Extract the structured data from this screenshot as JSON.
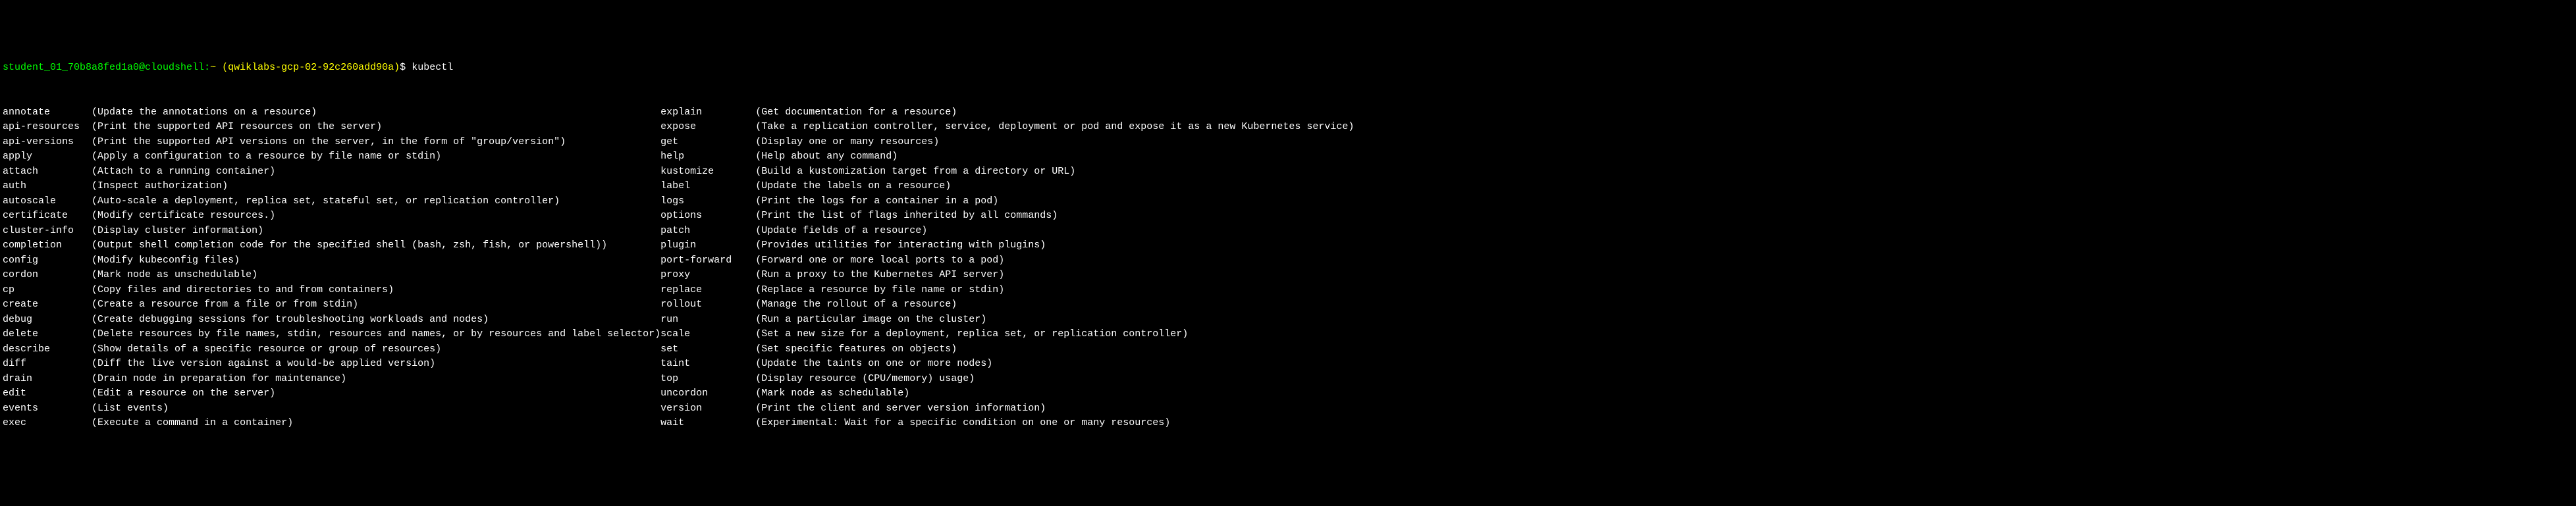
{
  "prompt": {
    "user": "student_01_70b8a8fed1a0@cloudshell",
    "separator": ":",
    "tilde": "~",
    "path_open": " (",
    "path": "qwiklabs-gcp-02-92c260add90a",
    "path_close": ")",
    "dollar": "$ ",
    "command": "kubectl"
  },
  "left_commands": [
    {
      "name": "annotate",
      "desc": "(Update the annotations on a resource)"
    },
    {
      "name": "api-resources",
      "desc": "(Print the supported API resources on the server)"
    },
    {
      "name": "api-versions",
      "desc": "(Print the supported API versions on the server, in the form of \"group/version\")"
    },
    {
      "name": "apply",
      "desc": "(Apply a configuration to a resource by file name or stdin)"
    },
    {
      "name": "attach",
      "desc": "(Attach to a running container)"
    },
    {
      "name": "auth",
      "desc": "(Inspect authorization)"
    },
    {
      "name": "autoscale",
      "desc": "(Auto-scale a deployment, replica set, stateful set, or replication controller)"
    },
    {
      "name": "certificate",
      "desc": "(Modify certificate resources.)"
    },
    {
      "name": "cluster-info",
      "desc": "(Display cluster information)"
    },
    {
      "name": "completion",
      "desc": "(Output shell completion code for the specified shell (bash, zsh, fish, or powershell))"
    },
    {
      "name": "config",
      "desc": "(Modify kubeconfig files)"
    },
    {
      "name": "cordon",
      "desc": "(Mark node as unschedulable)"
    },
    {
      "name": "cp",
      "desc": "(Copy files and directories to and from containers)"
    },
    {
      "name": "create",
      "desc": "(Create a resource from a file or from stdin)"
    },
    {
      "name": "debug",
      "desc": "(Create debugging sessions for troubleshooting workloads and nodes)"
    },
    {
      "name": "delete",
      "desc": "(Delete resources by file names, stdin, resources and names, or by resources and label selector)"
    },
    {
      "name": "describe",
      "desc": "(Show details of a specific resource or group of resources)"
    },
    {
      "name": "diff",
      "desc": "(Diff the live version against a would-be applied version)"
    },
    {
      "name": "drain",
      "desc": "(Drain node in preparation for maintenance)"
    },
    {
      "name": "edit",
      "desc": "(Edit a resource on the server)"
    },
    {
      "name": "events",
      "desc": "(List events)"
    },
    {
      "name": "exec",
      "desc": "(Execute a command in a container)"
    }
  ],
  "right_commands": [
    {
      "name": "explain",
      "desc": "(Get documentation for a resource)"
    },
    {
      "name": "expose",
      "desc": "(Take a replication controller, service, deployment or pod and expose it as a new Kubernetes service)"
    },
    {
      "name": "get",
      "desc": "(Display one or many resources)"
    },
    {
      "name": "help",
      "desc": "(Help about any command)"
    },
    {
      "name": "kustomize",
      "desc": "(Build a kustomization target from a directory or URL)"
    },
    {
      "name": "label",
      "desc": "(Update the labels on a resource)"
    },
    {
      "name": "logs",
      "desc": "(Print the logs for a container in a pod)"
    },
    {
      "name": "options",
      "desc": "(Print the list of flags inherited by all commands)"
    },
    {
      "name": "patch",
      "desc": "(Update fields of a resource)"
    },
    {
      "name": "plugin",
      "desc": "(Provides utilities for interacting with plugins)"
    },
    {
      "name": "port-forward",
      "desc": "(Forward one or more local ports to a pod)"
    },
    {
      "name": "proxy",
      "desc": "(Run a proxy to the Kubernetes API server)"
    },
    {
      "name": "replace",
      "desc": "(Replace a resource by file name or stdin)"
    },
    {
      "name": "rollout",
      "desc": "(Manage the rollout of a resource)"
    },
    {
      "name": "run",
      "desc": "(Run a particular image on the cluster)"
    },
    {
      "name": "scale",
      "desc": "(Set a new size for a deployment, replica set, or replication controller)"
    },
    {
      "name": "set",
      "desc": "(Set specific features on objects)"
    },
    {
      "name": "taint",
      "desc": "(Update the taints on one or more nodes)"
    },
    {
      "name": "top",
      "desc": "(Display resource (CPU/memory) usage)"
    },
    {
      "name": "uncordon",
      "desc": "(Mark node as schedulable)"
    },
    {
      "name": "version",
      "desc": "(Print the client and server version information)"
    },
    {
      "name": "wait",
      "desc": "(Experimental: Wait for a specific condition on one or many resources)"
    }
  ]
}
